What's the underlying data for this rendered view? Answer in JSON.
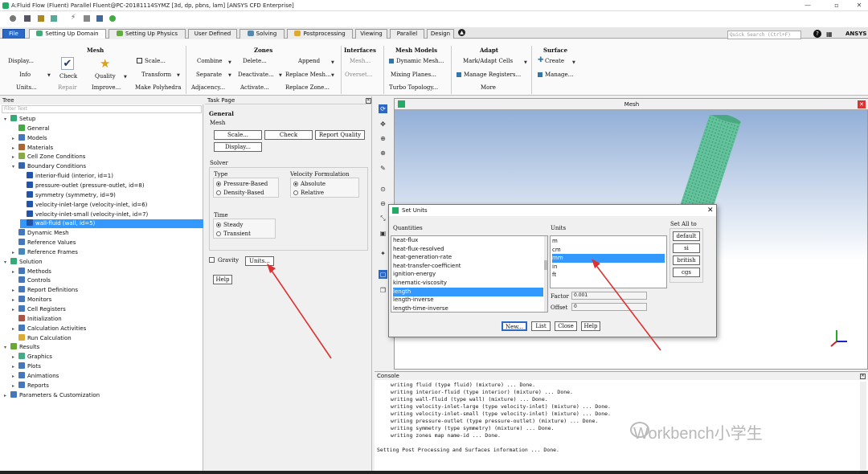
{
  "window": {
    "title": "A:Fluid Flow (Fluent) Parallel Fluent@PC-20181114SYMZ  [3d, dp, pbns, lam] [ANSYS CFD Enterprise]"
  },
  "tabs": [
    {
      "label": "File"
    },
    {
      "label": "Setting Up Domain"
    },
    {
      "label": "Setting Up Physics"
    },
    {
      "label": "User Defined"
    },
    {
      "label": "Solving"
    },
    {
      "label": "Postprocessing"
    },
    {
      "label": "Viewing"
    },
    {
      "label": "Parallel"
    },
    {
      "label": "Design"
    }
  ],
  "search": {
    "placeholder": "Quick Search (Ctrl+F)"
  },
  "brand": "ANSYS",
  "ribbon": {
    "mesh": {
      "title": "Mesh",
      "display": "Display...",
      "info": "Info",
      "units": "Units...",
      "check": "Check",
      "repair": "Repair",
      "quality": "Quality",
      "improve": "Improve...",
      "scale": "Scale...",
      "transform": "Transform",
      "make_polyhedra": "Make Polyhedra"
    },
    "zones": {
      "title": "Zones",
      "combine": "Combine",
      "separate": "Separate",
      "adjacency": "Adjacency...",
      "delete": "Delete...",
      "deactivate": "Deactivate...",
      "activate": "Activate...",
      "append": "Append",
      "replace_mesh": "Replace Mesh...",
      "replace_zone": "Replace Zone..."
    },
    "interfaces": {
      "title": "Interfaces",
      "mesh": "Mesh...",
      "overset": "Overset..."
    },
    "mesh_models": {
      "title": "Mesh Models",
      "dynamic_mesh": "Dynamic Mesh...",
      "mixing_planes": "Mixing Planes...",
      "turbo_topology": "Turbo Topology..."
    },
    "adapt": {
      "title": "Adapt",
      "mark_adapt": "Mark/Adapt Cells",
      "manage_registers": "Manage Registers...",
      "more": "More"
    },
    "surface": {
      "title": "Surface",
      "create": "Create",
      "manage": "Manage..."
    }
  },
  "tree": {
    "header": "Tree",
    "filter_placeholder": "Filter Text",
    "items": [
      {
        "label": "Setup"
      },
      {
        "label": "General"
      },
      {
        "label": "Models"
      },
      {
        "label": "Materials"
      },
      {
        "label": "Cell Zone Conditions"
      },
      {
        "label": "Boundary Conditions"
      },
      {
        "label": "interior-fluid (interior, id=1)"
      },
      {
        "label": "pressure-outlet (pressure-outlet, id=8)"
      },
      {
        "label": "symmetry (symmetry, id=9)"
      },
      {
        "label": "velocity-inlet-large (velocity-inlet, id=6)"
      },
      {
        "label": "velocity-inlet-small (velocity-inlet, id=7)"
      },
      {
        "label": "wall-fluid (wall, id=5)"
      },
      {
        "label": "Dynamic Mesh"
      },
      {
        "label": "Reference Values"
      },
      {
        "label": "Reference Frames"
      },
      {
        "label": "Solution"
      },
      {
        "label": "Methods"
      },
      {
        "label": "Controls"
      },
      {
        "label": "Report Definitions"
      },
      {
        "label": "Monitors"
      },
      {
        "label": "Cell Registers"
      },
      {
        "label": "Initialization"
      },
      {
        "label": "Calculation Activities"
      },
      {
        "label": "Run Calculation"
      },
      {
        "label": "Results"
      },
      {
        "label": "Graphics"
      },
      {
        "label": "Plots"
      },
      {
        "label": "Animations"
      },
      {
        "label": "Reports"
      },
      {
        "label": "Parameters & Customization"
      }
    ]
  },
  "task": {
    "header": "Task Page",
    "section": "General",
    "mesh_label": "Mesh",
    "scale": "Scale...",
    "check": "Check",
    "report_quality": "Report Quality",
    "display": "Display...",
    "solver_label": "Solver",
    "type_label": "Type",
    "type_options": [
      "Pressure-Based",
      "Density-Based"
    ],
    "velocity_label": "Velocity Formulation",
    "velocity_options": [
      "Absolute",
      "Relative"
    ],
    "time_label": "Time",
    "time_options": [
      "Steady",
      "Transient"
    ],
    "gravity": "Gravity",
    "units": "Units...",
    "help": "Help"
  },
  "mesh_window": {
    "title": "Mesh"
  },
  "dialog": {
    "title": "Set Units",
    "quantities_label": "Quantities",
    "quantities": [
      "heat-flux",
      "heat-flux-resolved",
      "heat-generation-rate",
      "heat-transfer-coefficient",
      "ignition-energy",
      "kinematic-viscosity",
      "length",
      "length-inverse",
      "length-time-inverse"
    ],
    "units_label": "Units",
    "units": [
      "m",
      "cm",
      "mm",
      "in",
      "ft"
    ],
    "set_all_label": "Set All to",
    "set_all": [
      "default",
      "si",
      "british",
      "cgs"
    ],
    "factor_label": "Factor",
    "factor_value": "0.001",
    "offset_label": "Offset",
    "offset_value": "0",
    "buttons": [
      "New...",
      "List",
      "Close",
      "Help"
    ]
  },
  "console": {
    "header": "Console",
    "lines": [
      "writing fluid (type fluid) (mixture) ... Done.",
      "writing interior-fluid (type interior) (mixture) ... Done.",
      "writing wall-fluid (type wall) (mixture) ... Done.",
      "writing velocity-inlet-large (type velocity-inlet) (mixture) ... Done.",
      "writing velocity-inlet-small (type velocity-inlet) (mixture) ... Done.",
      "writing pressure-outlet (type pressure-outlet) (mixture) ... Done.",
      "writing symmetry (type symmetry) (mixture) ... Done.",
      "writing zones map name-id ... Done.",
      "",
      "Setting Post Processing and Surfaces information ...      Done."
    ]
  },
  "watermark": "Workbench小学生",
  "colors": {
    "accent": "#3399ff",
    "file_tab": "#2a68c8",
    "arrow": "#e03030"
  }
}
